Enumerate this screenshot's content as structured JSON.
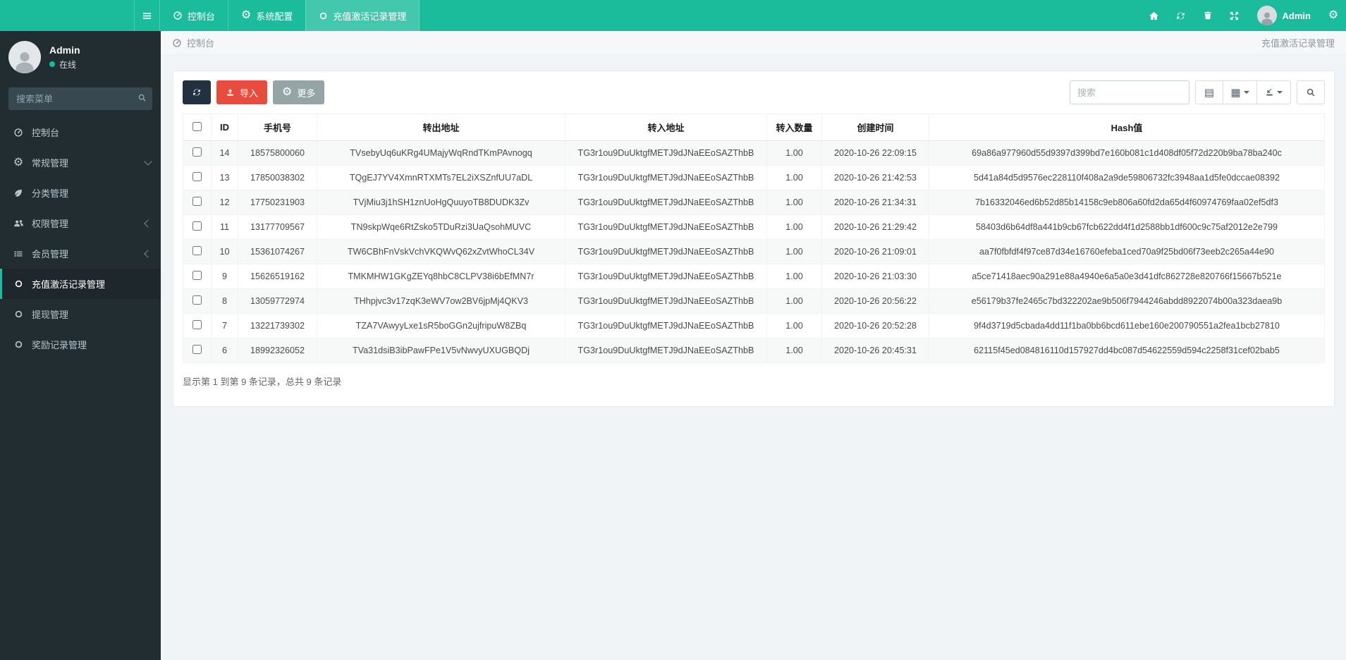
{
  "navbar": {
    "tabs": [
      {
        "icon": "tachometer",
        "label": "控制台",
        "active": false
      },
      {
        "icon": "gear",
        "label": "系统配置",
        "active": false
      },
      {
        "icon": "circle-o",
        "label": "充值激活记录管理",
        "active": true
      }
    ],
    "user_name": "Admin"
  },
  "sidebar": {
    "user_name": "Admin",
    "user_status": "在线",
    "search_placeholder": "搜索菜单",
    "items": [
      {
        "icon": "tachometer",
        "label": "控制台",
        "arrow": null,
        "active": false
      },
      {
        "icon": "gear",
        "label": "常规管理",
        "arrow": "down",
        "active": false
      },
      {
        "icon": "leaf",
        "label": "分类管理",
        "arrow": null,
        "active": false
      },
      {
        "icon": "users",
        "label": "权限管理",
        "arrow": "left",
        "active": false
      },
      {
        "icon": "list",
        "label": "会员管理",
        "arrow": "left",
        "active": false
      },
      {
        "icon": "circle-o",
        "label": "充值激活记录管理",
        "arrow": null,
        "active": true
      },
      {
        "icon": "circle-o",
        "label": "提现管理",
        "arrow": null,
        "active": false
      },
      {
        "icon": "circle-o",
        "label": "奖励记录管理",
        "arrow": null,
        "active": false
      }
    ]
  },
  "breadcrumb": {
    "left": "控制台",
    "right": "充值激活记录管理"
  },
  "toolbar": {
    "import_label": "导入",
    "more_label": "更多",
    "search_placeholder": "搜索"
  },
  "table": {
    "columns": [
      "ID",
      "手机号",
      "转出地址",
      "转入地址",
      "转入数量",
      "创建时间",
      "Hash值"
    ],
    "rows": [
      {
        "id": "14",
        "phone": "18575800060",
        "from": "TVsebyUq6uKRg4UMajyWqRndTKmPAvnogq",
        "to": "TG3r1ou9DuUktgfMETJ9dJNaEEoSAZThbB",
        "amount": "1.00",
        "created": "2020-10-26 22:09:15",
        "hash": "69a86a977960d55d9397d399bd7e160b081c1d408df05f72d220b9ba78ba240c"
      },
      {
        "id": "13",
        "phone": "17850038302",
        "from": "TQgEJ7YV4XmnRTXMTs7EL2iXSZnfUU7aDL",
        "to": "TG3r1ou9DuUktgfMETJ9dJNaEEoSAZThbB",
        "amount": "1.00",
        "created": "2020-10-26 21:42:53",
        "hash": "5d41a84d5d9576ec228110f408a2a9de59806732fc3948aa1d5fe0dccae08392"
      },
      {
        "id": "12",
        "phone": "17750231903",
        "from": "TVjMiu3j1hSH1znUoHgQuuyoTB8DUDK3Zv",
        "to": "TG3r1ou9DuUktgfMETJ9dJNaEEoSAZThbB",
        "amount": "1.00",
        "created": "2020-10-26 21:34:31",
        "hash": "7b16332046ed6b52d85b14158c9eb806a60fd2da65d4f60974769faa02ef5df3"
      },
      {
        "id": "11",
        "phone": "13177709567",
        "from": "TN9skpWqe6RtZsko5TDuRzi3UaQsohMUVC",
        "to": "TG3r1ou9DuUktgfMETJ9dJNaEEoSAZThbB",
        "amount": "1.00",
        "created": "2020-10-26 21:29:42",
        "hash": "58403d6b64df8a441b9cb67fcb622dd4f1d2588bb1df600c9c75af2012e2e799"
      },
      {
        "id": "10",
        "phone": "15361074267",
        "from": "TW6CBhFnVskVchVKQWvQ62xZvtWhoCL34V",
        "to": "TG3r1ou9DuUktgfMETJ9dJNaEEoSAZThbB",
        "amount": "1.00",
        "created": "2020-10-26 21:09:01",
        "hash": "aa7f0fbfdf4f97ce87d34e16760efeba1ced70a9f25bd06f73eeb2c265a44e90"
      },
      {
        "id": "9",
        "phone": "15626519162",
        "from": "TMKMHW1GKgZEYq8hbC8CLPV38i6bEfMN7r",
        "to": "TG3r1ou9DuUktgfMETJ9dJNaEEoSAZThbB",
        "amount": "1.00",
        "created": "2020-10-26 21:03:30",
        "hash": "a5ce71418aec90a291e88a4940e6a5a0e3d41dfc862728e820766f15667b521e"
      },
      {
        "id": "8",
        "phone": "13059772974",
        "from": "THhpjvc3v17zqK3eWV7ow2BV6jpMj4QKV3",
        "to": "TG3r1ou9DuUktgfMETJ9dJNaEEoSAZThbB",
        "amount": "1.00",
        "created": "2020-10-26 20:56:22",
        "hash": "e56179b37fe2465c7bd322202ae9b506f7944246abdd8922074b00a323daea9b"
      },
      {
        "id": "7",
        "phone": "13221739302",
        "from": "TZA7VAwyyLxe1sR5boGGn2ujfripuW8ZBq",
        "to": "TG3r1ou9DuUktgfMETJ9dJNaEEoSAZThbB",
        "amount": "1.00",
        "created": "2020-10-26 20:52:28",
        "hash": "9f4d3719d5cbada4dd11f1ba0bb6bcd611ebe160e200790551a2fea1bcb27810"
      },
      {
        "id": "6",
        "phone": "18992326052",
        "from": "TVa31dsiB3ibPawFPe1V5vNwvyUXUGBQDj",
        "to": "TG3r1ou9DuUktgfMETJ9dJNaEEoSAZThbB",
        "amount": "1.00",
        "created": "2020-10-26 20:45:31",
        "hash": "62115f45ed084816110d157927dd4bc087d54622559d594c2258f31cef02bab5"
      }
    ]
  },
  "footer_summary": "显示第 1 到第 9 条记录，总共 9 条记录",
  "colors": {
    "accent": "#1abc9c",
    "sidebar_bg": "#222d32",
    "active_item_bg": "#1e282c",
    "danger": "#e74c3c",
    "secondary": "#95a5a6",
    "dark_button": "#223140",
    "online_dot": "#18bc9c"
  }
}
